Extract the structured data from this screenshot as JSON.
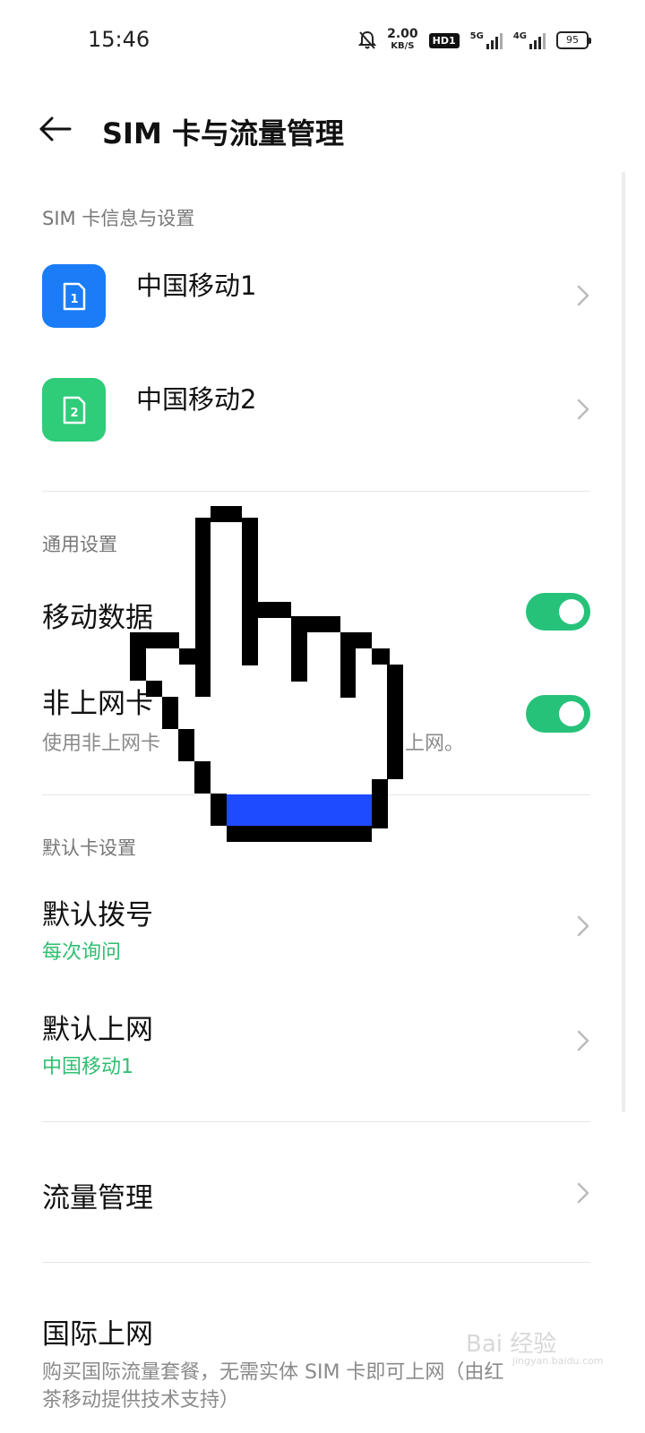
{
  "status_bar": {
    "time": "15:46",
    "net_speed": "2.00",
    "net_speed_unit": "KB/S",
    "hd_badge": "HD1",
    "sim1_network": "5G",
    "sim2_network": "4G",
    "battery": "95"
  },
  "header": {
    "title": "SIM 卡与流量管理"
  },
  "sim_section": {
    "title": "SIM 卡信息与设置",
    "cards": [
      {
        "name": "中国移动1",
        "number": "1",
        "color": "#1a7cf7"
      },
      {
        "name": "中国移动2",
        "number": "2",
        "color": "#2fcc7a"
      }
    ]
  },
  "general_section": {
    "title": "通用设置",
    "mobile_data": {
      "label": "移动数据",
      "enabled": true
    },
    "non_data_card": {
      "label": "非上网卡",
      "description_left": "使用非上网卡",
      "description_right": "上网。",
      "enabled": true
    }
  },
  "default_section": {
    "title": "默认卡设置",
    "default_call": {
      "label": "默认拨号",
      "value": "每次询问"
    },
    "default_data": {
      "label": "默认上网",
      "value": "中国移动1"
    }
  },
  "traffic": {
    "label": "流量管理"
  },
  "international": {
    "label": "国际上网",
    "description_line1": "购买国际流量套餐，无需实体 SIM 卡即可上网（由红",
    "description_line2": "茶移动提供技术支持）"
  },
  "watermark": {
    "text": "Bai 经验",
    "small": "jingyan.baidu.com"
  },
  "colors": {
    "accent_green": "#27c27a",
    "sim1_blue": "#1a7cf7",
    "pointer_fill": "#1e4bff"
  },
  "icons": [
    "back-arrow-icon",
    "sim-card-icon",
    "chevron-right-icon",
    "pointer-hand-icon",
    "mute-bell-icon"
  ]
}
